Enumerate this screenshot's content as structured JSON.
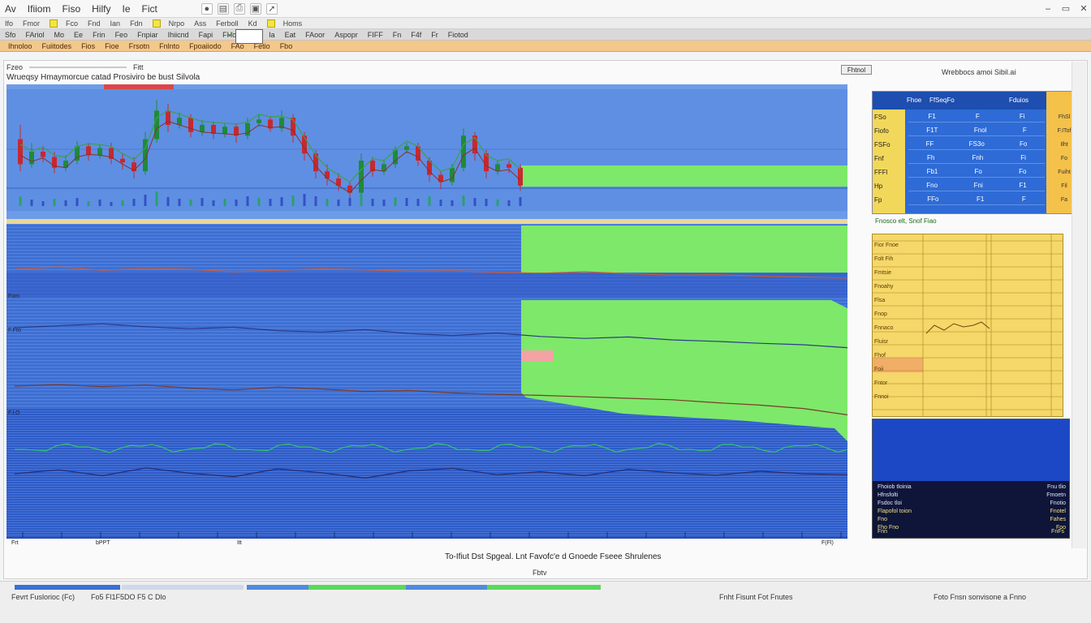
{
  "menubar": {
    "items": [
      "Av",
      "Ifiiom",
      "Fiso",
      "Hilfy",
      "Ie",
      "Fict"
    ],
    "window_controls": [
      "▭",
      "✕"
    ]
  },
  "toolbar1": {
    "labels": [
      "Ifo",
      "Fmor",
      "Fco",
      "Fnd",
      "Ian",
      "Fdn",
      "Nrpo",
      "Ass",
      "Ferboll",
      "Kd",
      "Homs"
    ]
  },
  "toolbar2": {
    "labels": [
      "Sfo",
      "FAriol",
      "Mo",
      "Ee",
      "Frin",
      "Feo",
      "Fnpiar",
      "Ihiicnd",
      "Fapi",
      "FHoioio ktv",
      "Ia",
      "Eat",
      "FAoor",
      "Aspopr",
      "FIFF",
      "Fn",
      "F4f",
      "Fr",
      "Fiotod"
    ]
  },
  "toolbar3": {
    "labels": [
      "Ihnoloo",
      "Fuiitodes",
      "Fios",
      "Fioe",
      "Frsotn",
      "Fnlnto",
      "Fpoaiiodo",
      "FAo",
      "Fetio",
      "Fbo"
    ]
  },
  "chart_panel": {
    "tab_label": "Fzeo",
    "title": "Wrueqsy Hmaymorcue catad Prosiviro be bust Silvola",
    "badge": "Fitt",
    "axis_left": [
      "Fom",
      "F.Fro",
      "F.l.O"
    ],
    "axis_bottom": [
      "Frt",
      "bPPT",
      "Itt"
    ],
    "bottom_right": "F(Fl)"
  },
  "right_header": "Wrebbocs amoi Sibil.ai",
  "right_badge": "Fhtnol",
  "quote_table": {
    "header": [
      "Fhoe",
      "FfSeqFo",
      "Fduios"
    ],
    "rows": [
      {
        "label": "FSo",
        "c1": "F1",
        "c2": "F",
        "c3": "Fi",
        "side": "FhSl"
      },
      {
        "label": "Fiofo",
        "c1": "F1T",
        "c2": "Fnol",
        "c3": "F",
        "side": "F.ITof"
      },
      {
        "label": "FSFo",
        "c1": "FF",
        "c2": "FS3o",
        "c3": "Fo",
        "side": "Ilht"
      },
      {
        "label": "Fnf",
        "c1": "Fh",
        "c2": "Fnh",
        "c3": "Fi",
        "side": "Fo"
      },
      {
        "label": "FFFl",
        "c1": "Fb1",
        "c2": "Fo",
        "c3": "Fo",
        "side": "Fuiht"
      },
      {
        "label": "Hp",
        "c1": "Fno",
        "c2": "Fni",
        "c3": "F1",
        "side": "Fil"
      },
      {
        "label": "Fp",
        "c1": "FFo",
        "c2": "F1",
        "c3": "F",
        "side": "Fa"
      }
    ]
  },
  "right_caption": "Fnosco elt, Snof Fiao",
  "yellow_table": {
    "rows": [
      "Fior Fnoe",
      "Folt Fih",
      "Fmtsie",
      "Fnoahy",
      "Flsa",
      "Fnop",
      "Fnnaco",
      "Fluisr",
      "Fhof",
      "Foii",
      "Fntor",
      "Fnnoi"
    ]
  },
  "dark_table": {
    "rows": [
      {
        "a": "Fhoiob tloinia",
        "b": "Fnu tlio"
      },
      {
        "a": "Hfnsfolti",
        "b": "Fmoetn"
      },
      {
        "a": "Fsdoc tloi",
        "b": "Fnotio"
      },
      {
        "a": "Flapofol toion",
        "b": "Fnotel"
      },
      {
        "a": "Fno",
        "b": "Fahes"
      },
      {
        "a": "Fho Fno",
        "b": "Foo"
      }
    ],
    "footer_left": "Fnn",
    "footer_right": "FnFs"
  },
  "bottom_caption": "To-Ifiut Dst Spgeal. Lnt Favofc'e d Gnoede Fseee Shrulenes",
  "page_num": "Fbtv",
  "status_bar": {
    "left": "Fevrt Fuslorioc (Fc)",
    "mid": "Fo5 Fl1F5DO F5 C Dlo",
    "right_mid": "Fnht Fisunt  Fot Fnutes",
    "right": "Foto Fnsn sonvisone a Fnno"
  },
  "colors": {
    "chart_blue": "#4a7fd8",
    "chart_blue_dark": "#2c56c4",
    "chart_green": "#7ee86a",
    "candle_up": "#1f8a3a",
    "candle_down": "#c8282e",
    "toolbar_orange": "#f4c78a"
  },
  "chart_data": {
    "type": "line",
    "candles": [
      {
        "o": 62,
        "c": 48,
        "h": 70,
        "l": 44
      },
      {
        "o": 48,
        "c": 55,
        "h": 60,
        "l": 46
      },
      {
        "o": 55,
        "c": 52,
        "h": 58,
        "l": 49
      },
      {
        "o": 52,
        "c": 46,
        "h": 55,
        "l": 43
      },
      {
        "o": 46,
        "c": 50,
        "h": 53,
        "l": 44
      },
      {
        "o": 50,
        "c": 58,
        "h": 61,
        "l": 48
      },
      {
        "o": 58,
        "c": 53,
        "h": 60,
        "l": 50
      },
      {
        "o": 53,
        "c": 57,
        "h": 59,
        "l": 51
      },
      {
        "o": 57,
        "c": 51,
        "h": 60,
        "l": 48
      },
      {
        "o": 51,
        "c": 49,
        "h": 54,
        "l": 45
      },
      {
        "o": 49,
        "c": 44,
        "h": 52,
        "l": 40
      },
      {
        "o": 44,
        "c": 62,
        "h": 66,
        "l": 42
      },
      {
        "o": 62,
        "c": 78,
        "h": 84,
        "l": 60
      },
      {
        "o": 78,
        "c": 70,
        "h": 82,
        "l": 66
      },
      {
        "o": 70,
        "c": 74,
        "h": 77,
        "l": 68
      },
      {
        "o": 74,
        "c": 66,
        "h": 76,
        "l": 63
      },
      {
        "o": 66,
        "c": 70,
        "h": 73,
        "l": 64
      },
      {
        "o": 70,
        "c": 65,
        "h": 72,
        "l": 62
      },
      {
        "o": 65,
        "c": 69,
        "h": 71,
        "l": 63
      },
      {
        "o": 69,
        "c": 64,
        "h": 71,
        "l": 60
      },
      {
        "o": 64,
        "c": 71,
        "h": 74,
        "l": 62
      },
      {
        "o": 71,
        "c": 73,
        "h": 76,
        "l": 69
      },
      {
        "o": 73,
        "c": 68,
        "h": 75,
        "l": 66
      },
      {
        "o": 68,
        "c": 74,
        "h": 78,
        "l": 66
      },
      {
        "o": 74,
        "c": 64,
        "h": 76,
        "l": 60
      },
      {
        "o": 64,
        "c": 54,
        "h": 66,
        "l": 50
      },
      {
        "o": 54,
        "c": 44,
        "h": 56,
        "l": 40
      },
      {
        "o": 44,
        "c": 40,
        "h": 48,
        "l": 36
      },
      {
        "o": 40,
        "c": 36,
        "h": 43,
        "l": 33
      },
      {
        "o": 36,
        "c": 32,
        "h": 38,
        "l": 28
      },
      {
        "o": 32,
        "c": 50,
        "h": 54,
        "l": 30
      },
      {
        "o": 50,
        "c": 44,
        "h": 52,
        "l": 41
      },
      {
        "o": 44,
        "c": 48,
        "h": 50,
        "l": 42
      },
      {
        "o": 48,
        "c": 56,
        "h": 58,
        "l": 46
      },
      {
        "o": 56,
        "c": 58,
        "h": 60,
        "l": 54
      },
      {
        "o": 58,
        "c": 50,
        "h": 60,
        "l": 47
      },
      {
        "o": 50,
        "c": 42,
        "h": 52,
        "l": 38
      },
      {
        "o": 42,
        "c": 38,
        "h": 44,
        "l": 34
      },
      {
        "o": 38,
        "c": 46,
        "h": 48,
        "l": 36
      },
      {
        "o": 46,
        "c": 64,
        "h": 68,
        "l": 44
      },
      {
        "o": 64,
        "c": 54,
        "h": 66,
        "l": 50
      },
      {
        "o": 54,
        "c": 44,
        "h": 56,
        "l": 40
      },
      {
        "o": 44,
        "c": 48,
        "h": 50,
        "l": 42
      },
      {
        "o": 48,
        "c": 46,
        "h": 50,
        "l": 43
      },
      {
        "o": 46,
        "c": 36,
        "h": 48,
        "l": 33
      }
    ],
    "volume": [
      12,
      8,
      6,
      9,
      7,
      10,
      6,
      8,
      5,
      7,
      9,
      14,
      18,
      11,
      9,
      8,
      10,
      7,
      9,
      8,
      12,
      10,
      9,
      11,
      13,
      15,
      12,
      9,
      8,
      10,
      14,
      9,
      8,
      11,
      10,
      9,
      12,
      8,
      7,
      13,
      10,
      9,
      8,
      7,
      11
    ],
    "lower_lines": [
      {
        "name": "",
        "values": [
          72,
          72.5,
          71.8,
          72.2,
          72,
          71.5,
          71.8,
          72.1,
          71.9,
          71.6,
          71.7,
          71.4,
          71.2,
          71.5,
          71.1,
          70.8,
          70.9,
          70.6,
          70.4,
          70.2
        ]
      },
      {
        "name": "",
        "values": [
          60,
          60.4,
          60.8,
          60.2,
          59.8,
          60.1,
          59.4,
          59.1,
          59.6,
          58.8,
          58.4,
          58.9,
          58.2,
          57.8,
          58.1,
          57.5,
          57.2,
          56.8,
          56.5,
          55.9
        ]
      },
      {
        "name": "",
        "values": [
          48,
          48.3,
          47.9,
          48.2,
          47.6,
          47.2,
          47.8,
          47.4,
          46.9,
          47.1,
          46.6,
          46.3,
          46.1,
          45.8,
          45.5,
          45.2,
          44.6,
          44.1,
          43.4,
          42.1
        ]
      },
      {
        "name": "",
        "values": [
          30,
          30.8,
          29.6,
          31.2,
          30.1,
          29.4,
          31.0,
          30.2,
          29.1,
          30.6,
          31.1,
          29.8,
          30.4,
          29.6,
          30.9,
          30.2,
          29.7,
          30.5,
          30.0,
          29.8
        ]
      }
    ]
  }
}
